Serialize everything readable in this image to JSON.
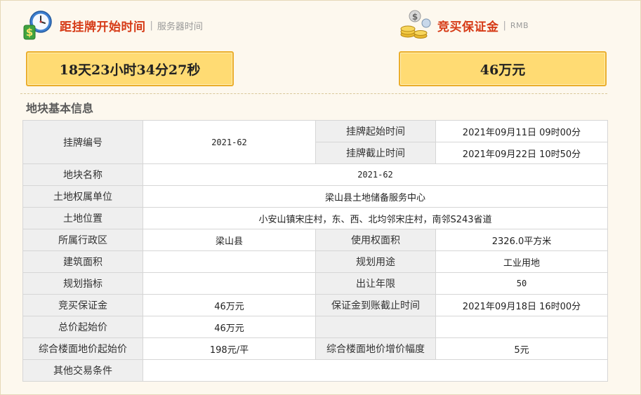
{
  "countdown": {
    "title": "距挂牌开始时间",
    "subtitle": "服务器时间",
    "value": "18天23小时34分27秒",
    "icon": "clock-money-icon"
  },
  "deposit": {
    "title": "竞买保证金",
    "subtitle": "RMB",
    "value": "46万元",
    "icon": "coins-money-icon"
  },
  "section_title": "地块基本信息",
  "table": {
    "listing_no_label": "挂牌编号",
    "listing_no": "2021-62",
    "start_time_label": "挂牌起始时间",
    "start_time": "2021年09月11日 09时00分",
    "end_time_label": "挂牌截止时间",
    "end_time": "2021年09月22日 10时50分",
    "parcel_name_label": "地块名称",
    "parcel_name": "2021-62",
    "owner_label": "土地权属单位",
    "owner": "梁山县土地储备服务中心",
    "location_label": "土地位置",
    "location": "小安山镇宋庄村，东、西、北均邻宋庄村，南邻S243省道",
    "district_label": "所属行政区",
    "district": "梁山县",
    "use_area_label": "使用权面积",
    "use_area": "2326.0平方米",
    "building_area_label": "建筑面积",
    "building_area": "",
    "planned_use_label": "规划用途",
    "planned_use": "工业用地",
    "plan_index_label": "规划指标",
    "plan_index": "",
    "term_label": "出让年限",
    "term": "50",
    "deposit_label": "竞买保证金",
    "deposit": "46万元",
    "deposit_deadline_label": "保证金到账截止时间",
    "deposit_deadline": "2021年09月18日 16时00分",
    "start_price_label": "总价起始价",
    "start_price": "46万元",
    "floor_price_label": "综合楼面地价起始价",
    "floor_price": "198元/平",
    "increment_label": "综合楼面地价增价幅度",
    "increment": "5元",
    "other_label": "其他交易条件",
    "other": ""
  },
  "colors": {
    "accent_red": "#d63a16",
    "box_fill": "#ffdb73",
    "box_border": "#ebae2c",
    "label_bg": "#efefef",
    "page_bg": "#fdf8ee"
  }
}
